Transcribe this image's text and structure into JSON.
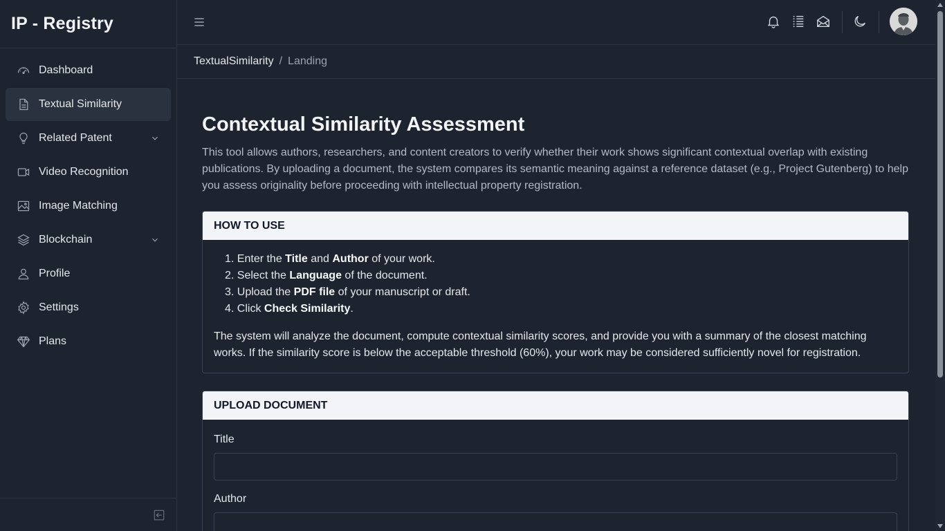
{
  "app": {
    "title": "IP - Registry"
  },
  "sidebar": {
    "items": [
      {
        "label": "Dashboard",
        "icon": "gauge-icon"
      },
      {
        "label": "Textual Similarity",
        "icon": "document-icon",
        "active": true
      },
      {
        "label": "Related Patent",
        "icon": "lightbulb-icon",
        "has_submenu": true
      },
      {
        "label": "Video Recognition",
        "icon": "video-icon"
      },
      {
        "label": "Image Matching",
        "icon": "image-icon"
      },
      {
        "label": "Blockchain",
        "icon": "layers-icon",
        "has_submenu": true
      },
      {
        "label": "Profile",
        "icon": "user-icon"
      },
      {
        "label": "Settings",
        "icon": "gear-icon"
      },
      {
        "label": "Plans",
        "icon": "diamond-icon"
      }
    ]
  },
  "breadcrumb": {
    "parent": "TextualSimilarity",
    "separator": "/",
    "current": "Landing"
  },
  "main": {
    "title": "Contextual Similarity Assessment",
    "intro": "This tool allows authors, researchers, and content creators to verify whether their work shows significant contextual overlap with existing publications. By uploading a document, the system compares its semantic meaning against a reference dataset (e.g., Project Gutenberg) to help you assess originality before proceeding with intellectual property registration."
  },
  "how_to_use": {
    "header": "HOW TO USE",
    "steps": [
      {
        "num": "1.",
        "a": "Enter the ",
        "b1": "Title",
        "c": " and ",
        "b2": "Author",
        "d": " of your work."
      },
      {
        "num": "2.",
        "a": "Select the ",
        "b1": "Language",
        "c": " of the document."
      },
      {
        "num": "3.",
        "a": "Upload the ",
        "b1": "PDF file",
        "c": " of your manuscript or draft."
      },
      {
        "num": "4.",
        "a": "Click ",
        "b1": "Check Similarity",
        "c": "."
      }
    ],
    "note": "The system will analyze the document, compute contextual similarity scores, and provide you with a summary of the closest matching works. If the similarity score is below the acceptable threshold (60%), your work may be considered sufficiently novel for registration."
  },
  "upload": {
    "header": "UPLOAD DOCUMENT",
    "title_label": "Title",
    "title_value": "",
    "author_label": "Author",
    "author_value": ""
  },
  "colors": {
    "background": "#1d2430",
    "card_header": "#f3f4f8",
    "border": "#3a4252"
  }
}
